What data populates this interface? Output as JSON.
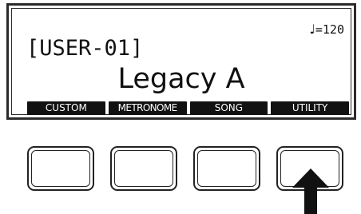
{
  "display": {
    "tempo": {
      "note_icon": "quarter-note-icon",
      "note_glyph": "♩",
      "value": "=120"
    },
    "user_slot": "[USER-01]",
    "voice_name": "Legacy A",
    "softkeys": [
      "CUSTOM",
      "METRONOME",
      "SONG",
      "UTILITY"
    ]
  },
  "buttons": [
    {
      "name": "F1"
    },
    {
      "name": "F2"
    },
    {
      "name": "F3"
    },
    {
      "name": "F4"
    }
  ],
  "indicator": {
    "icon": "up-arrow-icon",
    "target_button_index": 3
  },
  "colors": {
    "lcd_text": "#111111",
    "softkey_bg": "#111111",
    "softkey_text": "#ffffff",
    "outline": "#222222"
  }
}
